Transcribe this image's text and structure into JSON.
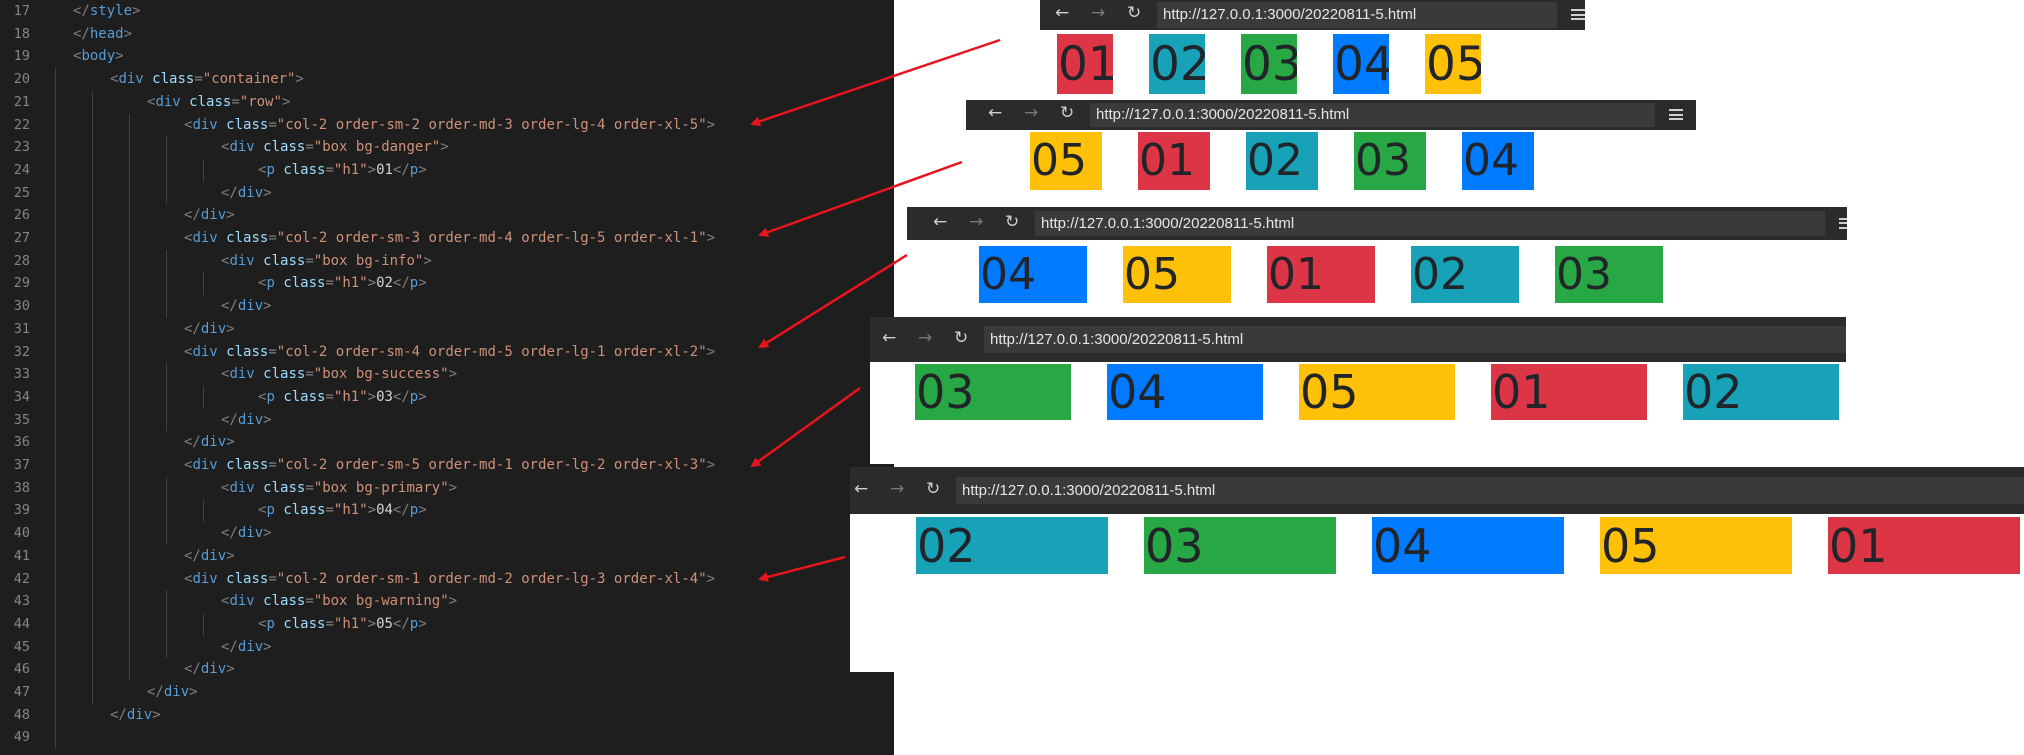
{
  "editor": {
    "lines": [
      {
        "n": "17",
        "indent": 0,
        "tokens": [
          [
            "punct",
            "</"
          ],
          [
            "tag",
            "style"
          ],
          [
            "punct",
            ">"
          ]
        ]
      },
      {
        "n": "18",
        "indent": 0,
        "tokens": [
          [
            "punct",
            "</"
          ],
          [
            "tag",
            "head"
          ],
          [
            "punct",
            ">"
          ]
        ]
      },
      {
        "n": "19",
        "indent": 0,
        "tokens": [
          [
            "punct",
            "<"
          ],
          [
            "tag",
            "body"
          ],
          [
            "punct",
            ">"
          ]
        ]
      },
      {
        "n": "20",
        "indent": 1,
        "tokens": [
          [
            "punct",
            "<"
          ],
          [
            "tag",
            "div"
          ],
          [
            "text",
            " "
          ],
          [
            "attr",
            "class"
          ],
          [
            "punct",
            "="
          ],
          [
            "val",
            "\"container\""
          ],
          [
            "punct",
            ">"
          ]
        ]
      },
      {
        "n": "21",
        "indent": 2,
        "tokens": [
          [
            "punct",
            "<"
          ],
          [
            "tag",
            "div"
          ],
          [
            "text",
            " "
          ],
          [
            "attr",
            "class"
          ],
          [
            "punct",
            "="
          ],
          [
            "val",
            "\"row\""
          ],
          [
            "punct",
            ">"
          ]
        ]
      },
      {
        "n": "22",
        "indent": 3,
        "tokens": [
          [
            "punct",
            "<"
          ],
          [
            "tag",
            "div"
          ],
          [
            "text",
            " "
          ],
          [
            "attr",
            "class"
          ],
          [
            "punct",
            "="
          ],
          [
            "val",
            "\"col-2 order-sm-2 order-md-3 order-lg-4 order-xl-5\""
          ],
          [
            "punct",
            ">"
          ]
        ]
      },
      {
        "n": "23",
        "indent": 4,
        "tokens": [
          [
            "punct",
            "<"
          ],
          [
            "tag",
            "div"
          ],
          [
            "text",
            " "
          ],
          [
            "attr",
            "class"
          ],
          [
            "punct",
            "="
          ],
          [
            "val",
            "\"box bg-danger\""
          ],
          [
            "punct",
            ">"
          ]
        ]
      },
      {
        "n": "24",
        "indent": 5,
        "tokens": [
          [
            "punct",
            "<"
          ],
          [
            "tag",
            "p"
          ],
          [
            "text",
            " "
          ],
          [
            "attr",
            "class"
          ],
          [
            "punct",
            "="
          ],
          [
            "val",
            "\"h1\""
          ],
          [
            "punct",
            ">"
          ],
          [
            "text",
            "01"
          ],
          [
            "punct",
            "</"
          ],
          [
            "tag",
            "p"
          ],
          [
            "punct",
            ">"
          ]
        ]
      },
      {
        "n": "25",
        "indent": 4,
        "tokens": [
          [
            "punct",
            "</"
          ],
          [
            "tag",
            "div"
          ],
          [
            "punct",
            ">"
          ]
        ]
      },
      {
        "n": "26",
        "indent": 3,
        "tokens": [
          [
            "punct",
            "</"
          ],
          [
            "tag",
            "div"
          ],
          [
            "punct",
            ">"
          ]
        ]
      },
      {
        "n": "27",
        "indent": 3,
        "tokens": [
          [
            "punct",
            "<"
          ],
          [
            "tag",
            "div"
          ],
          [
            "text",
            " "
          ],
          [
            "attr",
            "class"
          ],
          [
            "punct",
            "="
          ],
          [
            "val",
            "\"col-2 order-sm-3 order-md-4 order-lg-5 order-xl-1\""
          ],
          [
            "punct",
            ">"
          ]
        ]
      },
      {
        "n": "28",
        "indent": 4,
        "tokens": [
          [
            "punct",
            "<"
          ],
          [
            "tag",
            "div"
          ],
          [
            "text",
            " "
          ],
          [
            "attr",
            "class"
          ],
          [
            "punct",
            "="
          ],
          [
            "val",
            "\"box bg-info\""
          ],
          [
            "punct",
            ">"
          ]
        ]
      },
      {
        "n": "29",
        "indent": 5,
        "tokens": [
          [
            "punct",
            "<"
          ],
          [
            "tag",
            "p"
          ],
          [
            "text",
            " "
          ],
          [
            "attr",
            "class"
          ],
          [
            "punct",
            "="
          ],
          [
            "val",
            "\"h1\""
          ],
          [
            "punct",
            ">"
          ],
          [
            "text",
            "02"
          ],
          [
            "punct",
            "</"
          ],
          [
            "tag",
            "p"
          ],
          [
            "punct",
            ">"
          ]
        ]
      },
      {
        "n": "30",
        "indent": 4,
        "tokens": [
          [
            "punct",
            "</"
          ],
          [
            "tag",
            "div"
          ],
          [
            "punct",
            ">"
          ]
        ]
      },
      {
        "n": "31",
        "indent": 3,
        "tokens": [
          [
            "punct",
            "</"
          ],
          [
            "tag",
            "div"
          ],
          [
            "punct",
            ">"
          ]
        ]
      },
      {
        "n": "32",
        "indent": 3,
        "tokens": [
          [
            "punct",
            "<"
          ],
          [
            "tag",
            "div"
          ],
          [
            "text",
            " "
          ],
          [
            "attr",
            "class"
          ],
          [
            "punct",
            "="
          ],
          [
            "val",
            "\"col-2 order-sm-4 order-md-5 order-lg-1 order-xl-2\""
          ],
          [
            "punct",
            ">"
          ]
        ]
      },
      {
        "n": "33",
        "indent": 4,
        "tokens": [
          [
            "punct",
            "<"
          ],
          [
            "tag",
            "div"
          ],
          [
            "text",
            " "
          ],
          [
            "attr",
            "class"
          ],
          [
            "punct",
            "="
          ],
          [
            "val",
            "\"box bg-success\""
          ],
          [
            "punct",
            ">"
          ]
        ]
      },
      {
        "n": "34",
        "indent": 5,
        "tokens": [
          [
            "punct",
            "<"
          ],
          [
            "tag",
            "p"
          ],
          [
            "text",
            " "
          ],
          [
            "attr",
            "class"
          ],
          [
            "punct",
            "="
          ],
          [
            "val",
            "\"h1\""
          ],
          [
            "punct",
            ">"
          ],
          [
            "text",
            "03"
          ],
          [
            "punct",
            "</"
          ],
          [
            "tag",
            "p"
          ],
          [
            "punct",
            ">"
          ]
        ]
      },
      {
        "n": "35",
        "indent": 4,
        "tokens": [
          [
            "punct",
            "</"
          ],
          [
            "tag",
            "div"
          ],
          [
            "punct",
            ">"
          ]
        ]
      },
      {
        "n": "36",
        "indent": 3,
        "tokens": [
          [
            "punct",
            "</"
          ],
          [
            "tag",
            "div"
          ],
          [
            "punct",
            ">"
          ]
        ]
      },
      {
        "n": "37",
        "indent": 3,
        "tokens": [
          [
            "punct",
            "<"
          ],
          [
            "tag",
            "div"
          ],
          [
            "text",
            " "
          ],
          [
            "attr",
            "class"
          ],
          [
            "punct",
            "="
          ],
          [
            "val",
            "\"col-2 order-sm-5 order-md-1 order-lg-2 order-xl-3\""
          ],
          [
            "punct",
            ">"
          ]
        ]
      },
      {
        "n": "38",
        "indent": 4,
        "tokens": [
          [
            "punct",
            "<"
          ],
          [
            "tag",
            "div"
          ],
          [
            "text",
            " "
          ],
          [
            "attr",
            "class"
          ],
          [
            "punct",
            "="
          ],
          [
            "val",
            "\"box bg-primary\""
          ],
          [
            "punct",
            ">"
          ]
        ]
      },
      {
        "n": "39",
        "indent": 5,
        "tokens": [
          [
            "punct",
            "<"
          ],
          [
            "tag",
            "p"
          ],
          [
            "text",
            " "
          ],
          [
            "attr",
            "class"
          ],
          [
            "punct",
            "="
          ],
          [
            "val",
            "\"h1\""
          ],
          [
            "punct",
            ">"
          ],
          [
            "text",
            "04"
          ],
          [
            "punct",
            "</"
          ],
          [
            "tag",
            "p"
          ],
          [
            "punct",
            ">"
          ]
        ]
      },
      {
        "n": "40",
        "indent": 4,
        "tokens": [
          [
            "punct",
            "</"
          ],
          [
            "tag",
            "div"
          ],
          [
            "punct",
            ">"
          ]
        ]
      },
      {
        "n": "41",
        "indent": 3,
        "tokens": [
          [
            "punct",
            "</"
          ],
          [
            "tag",
            "div"
          ],
          [
            "punct",
            ">"
          ]
        ]
      },
      {
        "n": "42",
        "indent": 3,
        "tokens": [
          [
            "punct",
            "<"
          ],
          [
            "tag",
            "div"
          ],
          [
            "text",
            " "
          ],
          [
            "attr",
            "class"
          ],
          [
            "punct",
            "="
          ],
          [
            "val",
            "\"col-2 order-sm-1 order-md-2 order-lg-3 order-xl-4\""
          ],
          [
            "punct",
            ">"
          ]
        ]
      },
      {
        "n": "43",
        "indent": 4,
        "tokens": [
          [
            "punct",
            "<"
          ],
          [
            "tag",
            "div"
          ],
          [
            "text",
            " "
          ],
          [
            "attr",
            "class"
          ],
          [
            "punct",
            "="
          ],
          [
            "val",
            "\"box bg-warning\""
          ],
          [
            "punct",
            ">"
          ]
        ]
      },
      {
        "n": "44",
        "indent": 5,
        "tokens": [
          [
            "punct",
            "<"
          ],
          [
            "tag",
            "p"
          ],
          [
            "text",
            " "
          ],
          [
            "attr",
            "class"
          ],
          [
            "punct",
            "="
          ],
          [
            "val",
            "\"h1\""
          ],
          [
            "punct",
            ">"
          ],
          [
            "text",
            "05"
          ],
          [
            "punct",
            "</"
          ],
          [
            "tag",
            "p"
          ],
          [
            "punct",
            ">"
          ]
        ]
      },
      {
        "n": "45",
        "indent": 4,
        "tokens": [
          [
            "punct",
            "</"
          ],
          [
            "tag",
            "div"
          ],
          [
            "punct",
            ">"
          ]
        ]
      },
      {
        "n": "46",
        "indent": 3,
        "tokens": [
          [
            "punct",
            "</"
          ],
          [
            "tag",
            "div"
          ],
          [
            "punct",
            ">"
          ]
        ]
      },
      {
        "n": "47",
        "indent": 2,
        "tokens": [
          [
            "punct",
            "</"
          ],
          [
            "tag",
            "div"
          ],
          [
            "punct",
            ">"
          ]
        ]
      },
      {
        "n": "48",
        "indent": 1,
        "tokens": [
          [
            "punct",
            "</"
          ],
          [
            "tag",
            "div"
          ],
          [
            "punct",
            ">"
          ]
        ]
      },
      {
        "n": "49",
        "indent": 0,
        "tokens": []
      }
    ]
  },
  "colors": {
    "danger": "#dc3545",
    "info": "#17a2b8",
    "success": "#28a745",
    "primary": "#007bff",
    "warning": "#ffc107",
    "arrow": "#e8141d"
  },
  "icons": {
    "back": "back-arrow-icon",
    "forward": "forward-arrow-icon",
    "reload": "reload-icon",
    "menu": "hamburger-menu-icon"
  },
  "browsers": [
    {
      "url": "http://127.0.0.1:3000/20220811-5.html",
      "boxes": [
        {
          "text": "01",
          "color": "danger"
        },
        {
          "text": "02",
          "color": "info"
        },
        {
          "text": "03",
          "color": "success"
        },
        {
          "text": "04",
          "color": "primary"
        },
        {
          "text": "05",
          "color": "warning"
        }
      ]
    },
    {
      "url": "http://127.0.0.1:3000/20220811-5.html",
      "boxes": [
        {
          "text": "05",
          "color": "warning"
        },
        {
          "text": "01",
          "color": "danger"
        },
        {
          "text": "02",
          "color": "info"
        },
        {
          "text": "03",
          "color": "success"
        },
        {
          "text": "04",
          "color": "primary"
        }
      ]
    },
    {
      "url": "http://127.0.0.1:3000/20220811-5.html",
      "boxes": [
        {
          "text": "04",
          "color": "primary"
        },
        {
          "text": "05",
          "color": "warning"
        },
        {
          "text": "01",
          "color": "danger"
        },
        {
          "text": "02",
          "color": "info"
        },
        {
          "text": "03",
          "color": "success"
        }
      ]
    },
    {
      "url": "http://127.0.0.1:3000/20220811-5.html",
      "boxes": [
        {
          "text": "03",
          "color": "success"
        },
        {
          "text": "04",
          "color": "primary"
        },
        {
          "text": "05",
          "color": "warning"
        },
        {
          "text": "01",
          "color": "danger"
        },
        {
          "text": "02",
          "color": "info"
        }
      ]
    },
    {
      "url": "http://127.0.0.1:3000/20220811-5.html",
      "boxes": [
        {
          "text": "02",
          "color": "info"
        },
        {
          "text": "03",
          "color": "success"
        },
        {
          "text": "04",
          "color": "primary"
        },
        {
          "text": "05",
          "color": "warning"
        },
        {
          "text": "01",
          "color": "danger"
        }
      ]
    }
  ]
}
